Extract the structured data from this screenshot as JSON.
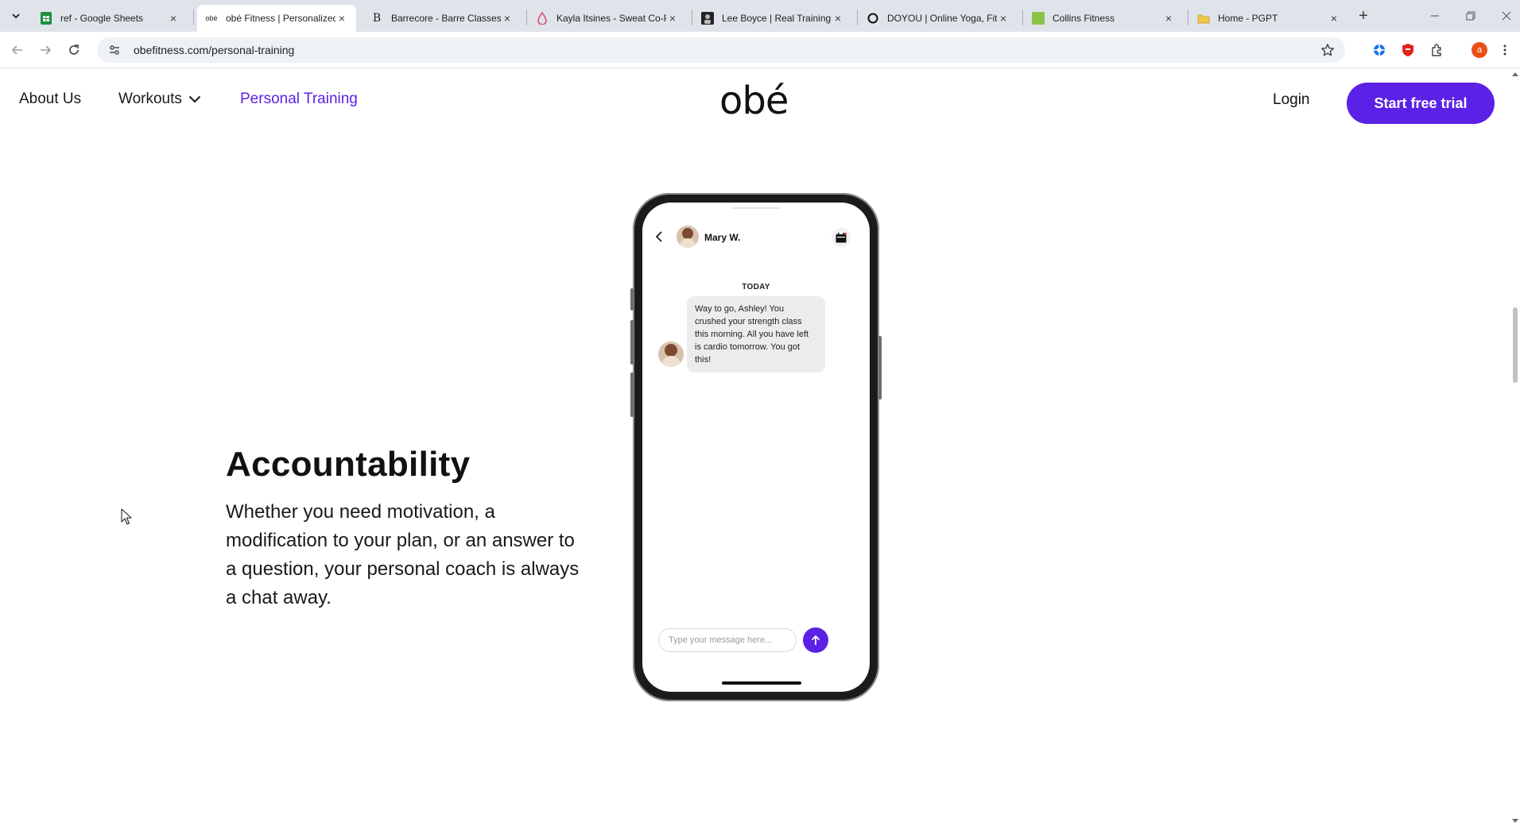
{
  "browser": {
    "tabs": [
      {
        "title": "ref - Google Sheets",
        "favicon": "sheets-icon",
        "active": false
      },
      {
        "title": "obé Fitness | Personalized",
        "favicon": "obe-icon",
        "active": true
      },
      {
        "title": "Barrecore - Barre Classes",
        "favicon": "barrecore-icon",
        "active": false
      },
      {
        "title": "Kayla Itsines - Sweat Co-F",
        "favicon": "sweat-icon",
        "active": false
      },
      {
        "title": "Lee Boyce | Real Training.",
        "favicon": "lee-boyce-icon",
        "active": false
      },
      {
        "title": "DOYOU | Online Yoga, Fit",
        "favicon": "doyou-icon",
        "active": false
      },
      {
        "title": "Collins Fitness",
        "favicon": "collins-icon",
        "active": false
      },
      {
        "title": "Home - PGPT",
        "favicon": "pgpt-icon",
        "active": false
      }
    ],
    "url": "obefitness.com/personal-training",
    "profile_initial": "a"
  },
  "site": {
    "nav": {
      "about": "About Us",
      "workouts": "Workouts",
      "personal_training": "Personal Training"
    },
    "logo": "obé",
    "login": "Login",
    "cta": "Start free trial"
  },
  "section": {
    "heading": "Accountability",
    "body": "Whether you need motivation, a modification to your plan, or an answer to a question, your personal coach is always a chat away."
  },
  "chat": {
    "contact_name": "Mary W.",
    "date_label": "TODAY",
    "message": "Way to go, Ashley! You crushed your strength class this morning. All you have left is cardio tomorrow. You got this!",
    "input_placeholder": "Type your message here..."
  },
  "colors": {
    "brand_purple": "#5b21e6",
    "tabstrip": "#dfe3ea"
  }
}
